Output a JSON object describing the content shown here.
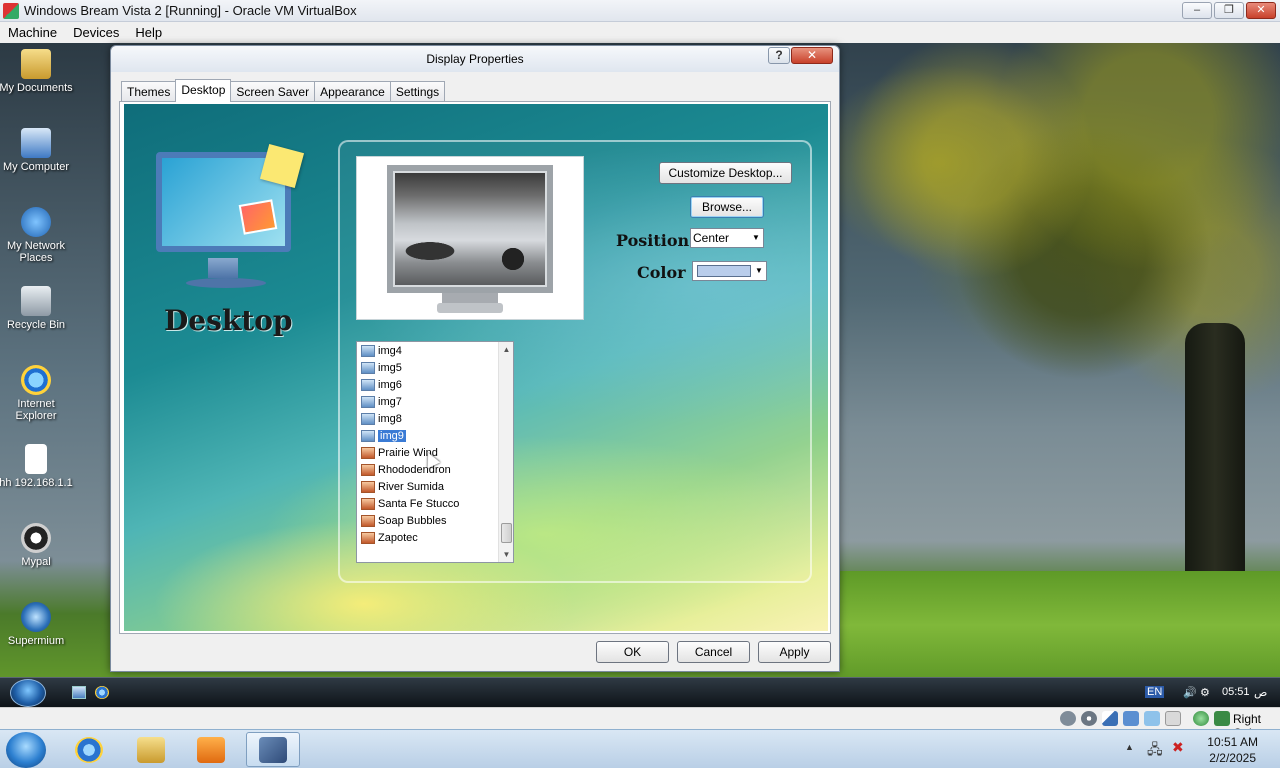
{
  "host_window": {
    "title": "Windows Bream Vista 2 [Running] - Oracle VM VirtualBox",
    "menu": [
      "Machine",
      "Devices",
      "Help"
    ],
    "buttons": {
      "minimize": "–",
      "restore": "❐",
      "close": "✕"
    }
  },
  "desktop_icons": [
    {
      "label": "My Documents",
      "icon": "folder-icon"
    },
    {
      "label": "My Computer",
      "icon": "computer-icon"
    },
    {
      "label": "My Network Places",
      "icon": "network-icon"
    },
    {
      "label": "Recycle Bin",
      "icon": "recycle-bin-icon"
    },
    {
      "label": "Internet Explorer",
      "icon": "internet-explorer-icon"
    },
    {
      "label": "hh 192.168.1.1",
      "icon": "file-icon"
    },
    {
      "label": "Mypal",
      "icon": "mypal-icon"
    },
    {
      "label": "Supermium",
      "icon": "supermium-icon"
    }
  ],
  "dialog": {
    "title": "Display Properties",
    "help_btn": "?",
    "close_btn": "✕",
    "tabs": [
      "Themes",
      "Desktop",
      "Screen Saver",
      "Appearance",
      "Settings"
    ],
    "active_tab": "Desktop",
    "desktop_heading": "Desktop",
    "customize_label": "Customize Desktop...",
    "browse_label": "Browse...",
    "position_label": "Position :",
    "position_value": "Center",
    "color_label": "Color :",
    "color_value": "#b9cdeb",
    "backgrounds": [
      {
        "name": "img4",
        "type": "image"
      },
      {
        "name": "img5",
        "type": "image"
      },
      {
        "name": "img6",
        "type": "image"
      },
      {
        "name": "img7",
        "type": "image"
      },
      {
        "name": "img8",
        "type": "image"
      },
      {
        "name": "img9",
        "type": "image",
        "selected": true
      },
      {
        "name": "Prairie Wind",
        "type": "jpg"
      },
      {
        "name": "Rhododendron",
        "type": "jpg"
      },
      {
        "name": "River Sumida",
        "type": "jpg"
      },
      {
        "name": "Santa Fe Stucco",
        "type": "jpg"
      },
      {
        "name": "Soap Bubbles",
        "type": "jpg"
      },
      {
        "name": "Zapotec",
        "type": "jpg"
      }
    ],
    "ok_label": "OK",
    "cancel_label": "Cancel",
    "apply_label": "Apply"
  },
  "guest_taskbar": {
    "language": "EN",
    "time": "05:51",
    "ampm": "ص"
  },
  "vb_status": {
    "host_key": "Right Ctrl"
  },
  "host_taskbar": {
    "apps": [
      "internet-explorer",
      "file-explorer",
      "media-player",
      "virtualbox"
    ],
    "clock_time": "10:51 AM",
    "clock_date": "2/2/2025"
  }
}
